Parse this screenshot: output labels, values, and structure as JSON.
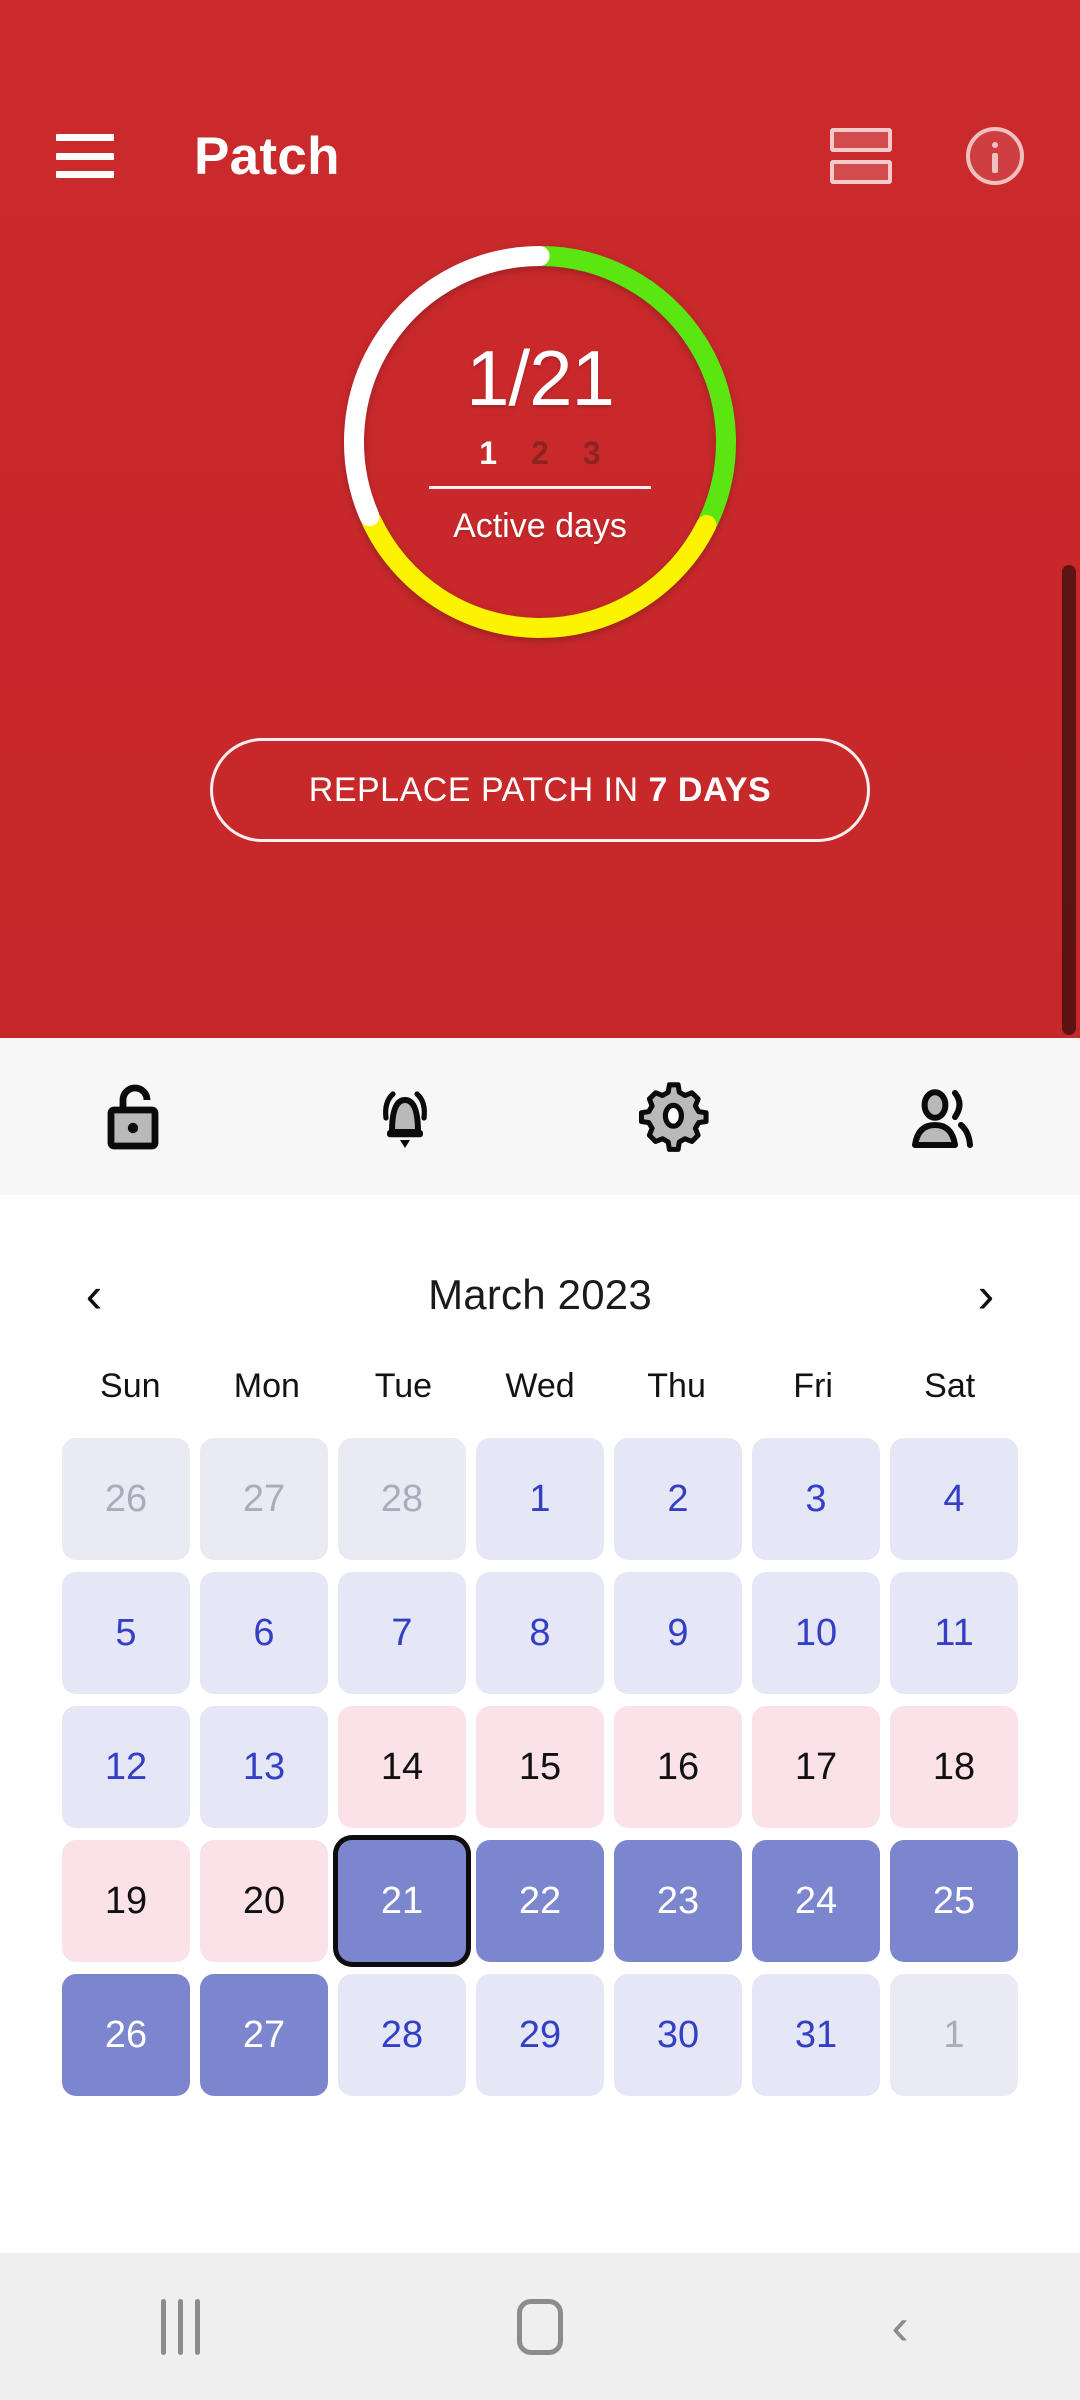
{
  "appbar": {
    "menu_icon": "hamburger-menu-icon",
    "title": "Patch",
    "rows_icon": "stacked-rows-icon",
    "info_icon": "info-circle-icon"
  },
  "hero": {
    "ring": {
      "fraction": "1/21",
      "steps": [
        "1",
        "2",
        "3"
      ],
      "active_step_index": 0,
      "label": "Active days",
      "arc_colors": {
        "green": "#5ce611",
        "yellow": "#fbf300",
        "white": "#ffffff",
        "track": "#b8332f"
      },
      "arc_spans_deg": {
        "green": 115,
        "yellow": 130,
        "white": 115
      }
    },
    "replace_button": {
      "prefix": "REPLACE PATCH IN ",
      "emphasis": "7 DAYS"
    },
    "background_color": "#c8272a"
  },
  "toolbar": {
    "items": [
      {
        "name": "lock-open-icon",
        "label": "Lock"
      },
      {
        "name": "alarm-bell-icon",
        "label": "Reminder"
      },
      {
        "name": "gear-icon",
        "label": "Settings"
      },
      {
        "name": "people-icon",
        "label": "Contacts"
      }
    ]
  },
  "calendar": {
    "prev_label": "‹",
    "next_label": "›",
    "title": "March 2023",
    "weekdays": [
      "Sun",
      "Mon",
      "Tue",
      "Wed",
      "Thu",
      "Fri",
      "Sat"
    ],
    "selected_day": "21",
    "days": [
      {
        "n": "26",
        "style": "muted"
      },
      {
        "n": "27",
        "style": "muted"
      },
      {
        "n": "28",
        "style": "muted"
      },
      {
        "n": "1",
        "style": "lav"
      },
      {
        "n": "2",
        "style": "lav"
      },
      {
        "n": "3",
        "style": "lav"
      },
      {
        "n": "4",
        "style": "lav"
      },
      {
        "n": "5",
        "style": "lav"
      },
      {
        "n": "6",
        "style": "lav"
      },
      {
        "n": "7",
        "style": "lav"
      },
      {
        "n": "8",
        "style": "lav"
      },
      {
        "n": "9",
        "style": "lav"
      },
      {
        "n": "10",
        "style": "lav"
      },
      {
        "n": "11",
        "style": "lav"
      },
      {
        "n": "12",
        "style": "lav"
      },
      {
        "n": "13",
        "style": "lav"
      },
      {
        "n": "14",
        "style": "pink"
      },
      {
        "n": "15",
        "style": "pink"
      },
      {
        "n": "16",
        "style": "pink"
      },
      {
        "n": "17",
        "style": "pink"
      },
      {
        "n": "18",
        "style": "pink"
      },
      {
        "n": "19",
        "style": "pink"
      },
      {
        "n": "20",
        "style": "pink"
      },
      {
        "n": "21",
        "style": "sel",
        "today": true
      },
      {
        "n": "22",
        "style": "sel"
      },
      {
        "n": "23",
        "style": "sel"
      },
      {
        "n": "24",
        "style": "sel"
      },
      {
        "n": "25",
        "style": "sel"
      },
      {
        "n": "26",
        "style": "sel"
      },
      {
        "n": "27",
        "style": "sel"
      },
      {
        "n": "28",
        "style": "lav"
      },
      {
        "n": "29",
        "style": "lav"
      },
      {
        "n": "30",
        "style": "lav"
      },
      {
        "n": "31",
        "style": "lav"
      },
      {
        "n": "1",
        "style": "muted"
      }
    ],
    "colors": {
      "lavender_bg": "#e5e7f6",
      "lavender_text": "#3340c4",
      "pink_bg": "#fbe2e9",
      "selected_bg": "#7b86ce"
    }
  },
  "system_nav": {
    "recents": "recents-icon",
    "home": "home-icon",
    "back": "back-icon"
  }
}
